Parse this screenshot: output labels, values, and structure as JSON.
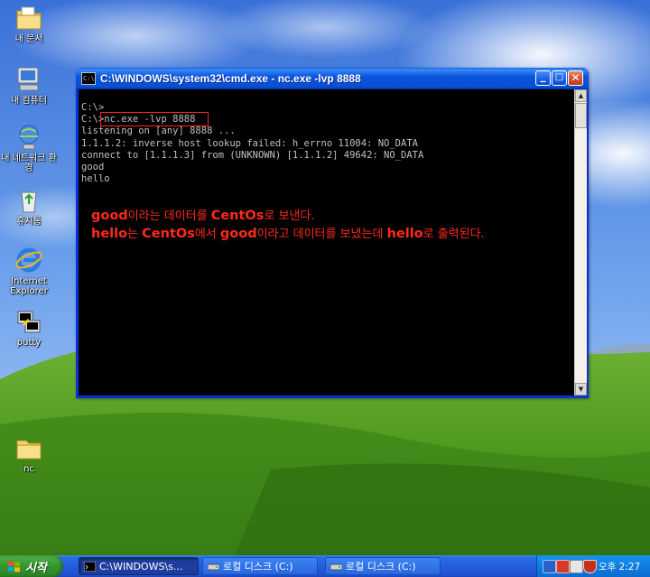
{
  "desktop": {
    "icons": [
      {
        "label": "내 문서"
      },
      {
        "label": "내 컴퓨터"
      },
      {
        "label": "내 네트워크 환경"
      },
      {
        "label": "휴지통"
      },
      {
        "label": "Internet Explorer"
      },
      {
        "label": "putty"
      },
      {
        "label": "nc"
      }
    ]
  },
  "window": {
    "title": "C:\\WINDOWS\\system32\\cmd.exe - nc.exe -lvp 8888",
    "icon_text": "C:\\",
    "buttons": {
      "minimize": "_",
      "maximize": "□",
      "close": "✕"
    }
  },
  "console": {
    "lines": [
      "C:\\>",
      "C:\\>nc.exe -lvp 8888",
      "listening on [any] 8888 ...",
      "1.1.1.2: inverse host lookup failed: h_errno 11004: NO_DATA",
      "connect to [1.1.1.3] from (UNKNOWN) [1.1.1.2] 49642: NO_DATA",
      "good",
      "hello"
    ],
    "text_color": "#c0c0c0",
    "background": "#000000"
  },
  "annotations": {
    "note1": {
      "w1": "good",
      "t1": "이라는 데이터를 ",
      "w2": "CentOs",
      "t2": "로 보낸다."
    },
    "note2": {
      "w1": "hello",
      "t1": "는 ",
      "w2": "CentOs",
      "t2": "에서 ",
      "w3": "good",
      "t3": "이라고 데이터를 보냈는데 ",
      "w4": "hello",
      "t4": "로 출력된다."
    },
    "color": "#ff2a1a"
  },
  "taskbar": {
    "start_label": "시작",
    "tasks": [
      {
        "label": "C:\\WINDOWS\\s...",
        "icon": "cmd-icon"
      },
      {
        "label": "로컬 디스크 (C:)",
        "icon": "drive-icon"
      },
      {
        "label": "로컬 디스크 (C:)",
        "icon": "drive-icon"
      }
    ],
    "tray_icons": [
      "network-icon",
      "security-icon",
      "speaker-icon",
      "shield-icon"
    ],
    "clock": "오후 2:27"
  }
}
